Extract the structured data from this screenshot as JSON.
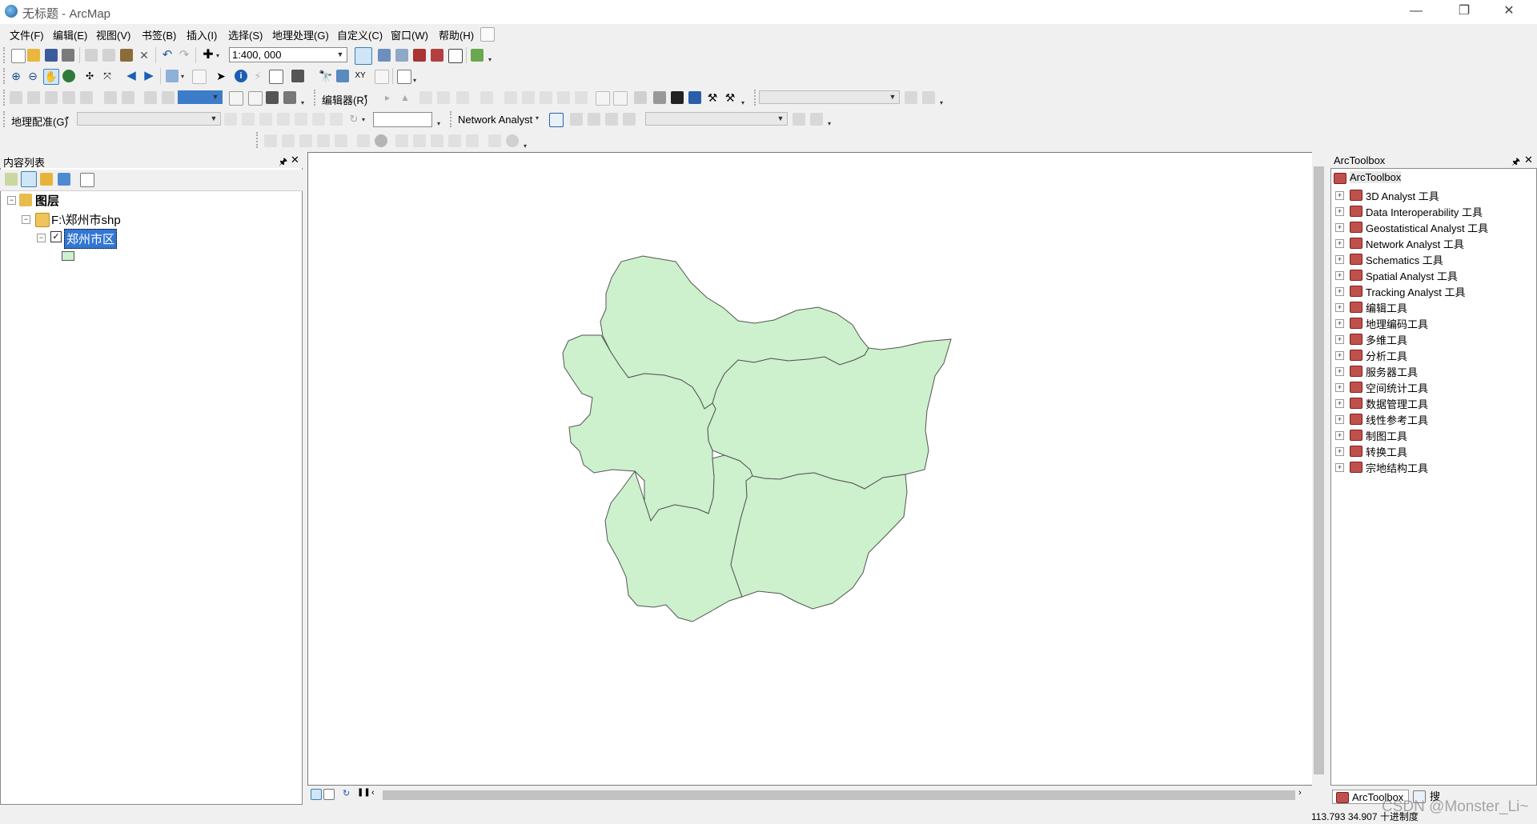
{
  "window": {
    "title": "无标题 - ArcMap",
    "controls": [
      "—",
      "❐",
      "✕"
    ]
  },
  "menu": [
    "文件(F)",
    "编辑(E)",
    "视图(V)",
    "书签(B)",
    "插入(I)",
    "选择(S)",
    "地理处理(G)",
    "自定义(C)",
    "窗口(W)",
    "帮助(H)"
  ],
  "toolbar": {
    "scale_value": "1:400, 000",
    "editor_label": "编辑器(R)",
    "georef_label": "地理配准(G)",
    "network_label": "Network Analyst"
  },
  "toc": {
    "title": "内容列表",
    "root_label": "图层",
    "folder_label": "F:\\郑州市shp",
    "layer_label": "郑州市区",
    "layer_checked": true,
    "symbol_color": "#cdf0cd"
  },
  "map": {
    "fill_color": "#cdf0cd",
    "stroke_color": "#555555"
  },
  "toolbox": {
    "title": "ArcToolbox",
    "root_label": "ArcToolbox",
    "items": [
      "3D Analyst 工具",
      "Data Interoperability 工具",
      "Geostatistical Analyst 工具",
      "Network Analyst 工具",
      "Schematics 工具",
      "Spatial Analyst 工具",
      "Tracking Analyst 工具",
      "编辑工具",
      "地理编码工具",
      "多维工具",
      "分析工具",
      "服务器工具",
      "空间统计工具",
      "数据管理工具",
      "线性参考工具",
      "制图工具",
      "转换工具",
      "宗地结构工具"
    ],
    "tabs": [
      "ArcToolbox",
      "搜索"
    ]
  },
  "status": {
    "coords": "113.793  34.907 十进制度",
    "watermark": "CSDN @Monster_Li~"
  }
}
